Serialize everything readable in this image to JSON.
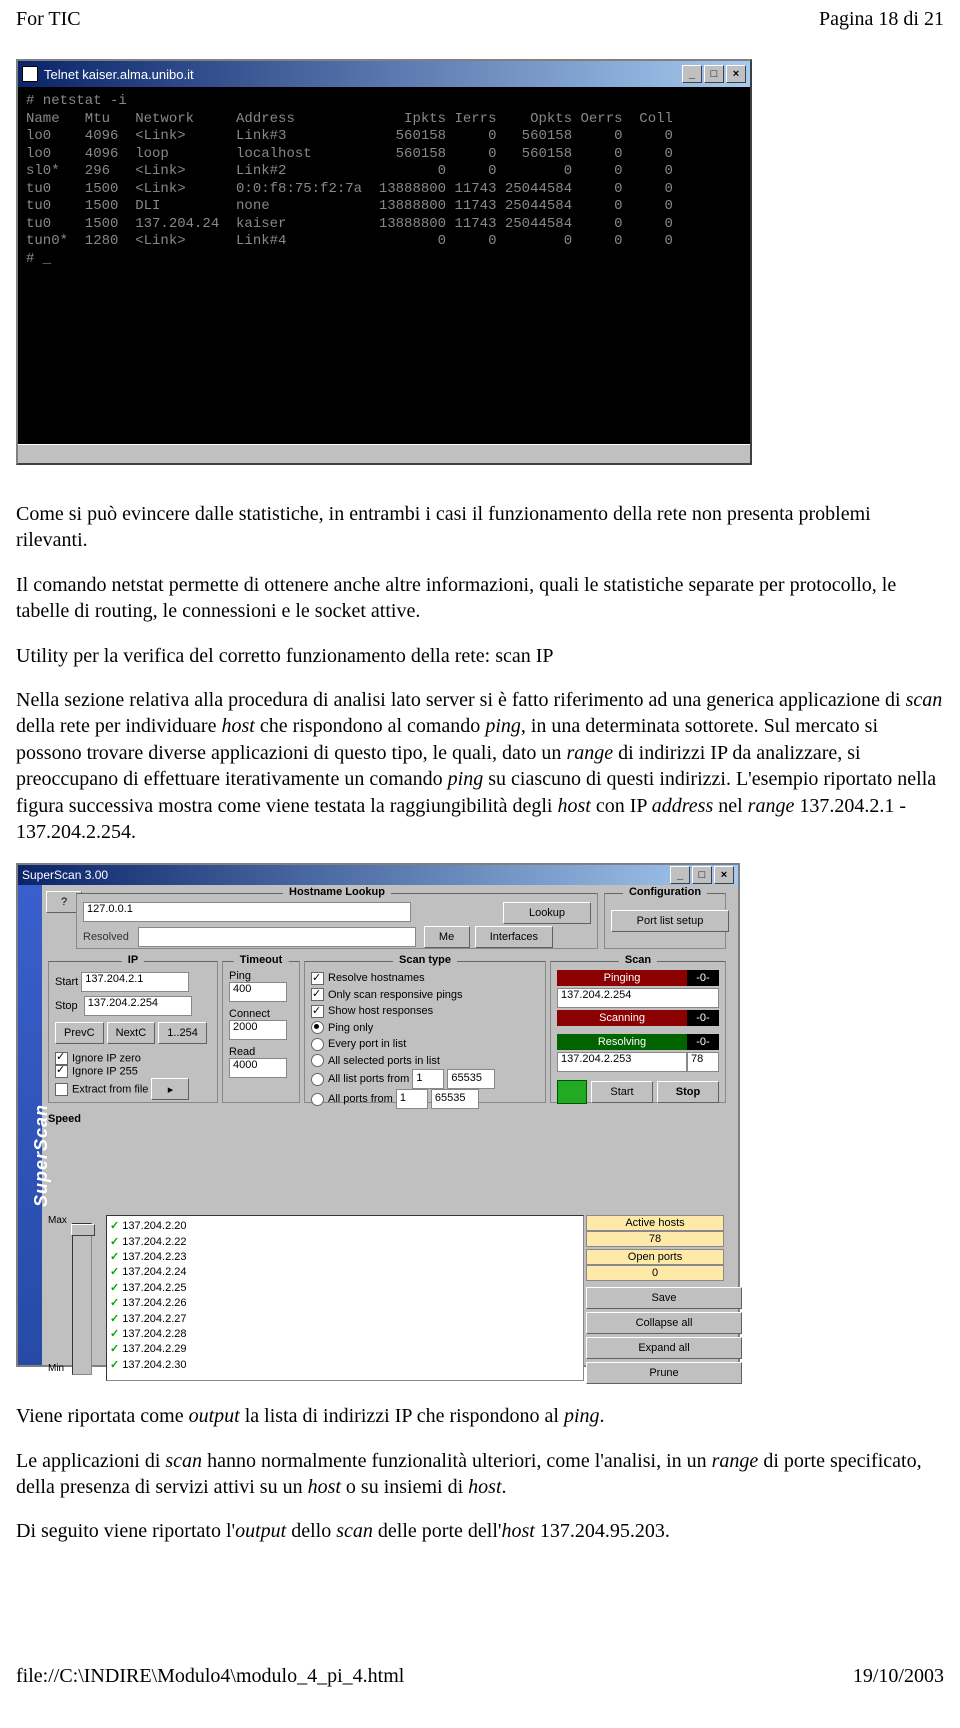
{
  "header": {
    "left": "For TIC",
    "right": "Pagina 18 di 21"
  },
  "telnet": {
    "title": "Telnet kaiser.alma.unibo.it",
    "cmd": "# netstat -i",
    "cols": "Name   Mtu   Network     Address             Ipkts Ierrs    Opkts Oerrs  Coll",
    "rows": [
      "lo0    4096  <Link>      Link#3             560158     0   560158     0     0",
      "lo0    4096  loop        localhost          560158     0   560158     0     0",
      "sl0*   296   <Link>      Link#2                  0     0        0     0     0",
      "tu0    1500  <Link>      0:0:f8:75:f2:7a  13888800 11743 25044584     0     0",
      "tu0    1500  DLI         none             13888800 11743 25044584     0     0",
      "tu0    1500  137.204.24  kaiser           13888800 11743 25044584     0     0",
      "tun0*  1280  <Link>      Link#4                  0     0        0     0     0",
      "# _"
    ]
  },
  "para1": "Come si può evincere dalle statistiche, in entrambi i casi il funzionamento della rete non presenta problemi rilevanti.",
  "para2": "Il comando netstat permette di ottenere anche altre informazioni, quali le statistiche separate per protocollo, le tabelle di routing, le connessioni e le socket attive.",
  "para3_title": "Utility per la verifica del corretto funzionamento della rete: scan IP",
  "para4_a": "Nella sezione relativa alla procedura di analisi lato server si è fatto riferimento ad una generica applicazione di ",
  "para4_b": "scan",
  "para4_c": " della rete per individuare ",
  "para4_d": "host",
  "para4_e": " che rispondono al comando ",
  "para4_f": "ping",
  "para4_g": ", in una determinata sottorete. Sul mercato si possono trovare diverse applicazioni di questo tipo, le quali, dato un ",
  "para4_h": "range",
  "para4_i": " di indirizzi IP da analizzare, si preoccupano di effettuare iterativamente un comando ",
  "para4_j": "ping",
  "para4_k": " su ciascuno di questi indirizzi. L'esempio riportato nella figura successiva mostra come viene testata la raggiungibilità degli ",
  "para4_l": "host",
  "para4_m": " con IP ",
  "para4_n": "address",
  "para4_o": " nel ",
  "para4_p": "range",
  "para4_q": " 137.204.2.1 - 137.204.2.254.",
  "superscan": {
    "title": "SuperScan 3.00",
    "hostname_lookup": "Hostname Lookup",
    "hostname_value": "127.0.0.1",
    "resolved_label": "Resolved",
    "lookup_btn": "Lookup",
    "me_btn": "Me",
    "interfaces_btn": "Interfaces",
    "configuration": "Configuration",
    "portlist_btn": "Port list setup",
    "ip_label": "IP",
    "start_label": "Start",
    "stop_label": "Stop",
    "start_ip": "137.204.2.1",
    "stop_ip": "137.204.2.254",
    "prevc": "PrevC",
    "nextc": "NextC",
    "one254": "1..254",
    "ignore_zero": "Ignore IP zero",
    "ignore_255": "Ignore IP 255",
    "extract": "Extract from file",
    "timeout": "Timeout",
    "ping_label": "Ping",
    "ping_val": "400",
    "connect_label": "Connect",
    "connect_val": "2000",
    "read_label": "Read",
    "read_val": "4000",
    "scantype": "Scan type",
    "resolve_host": "Resolve hostnames",
    "only_responsive": "Only scan responsive pings",
    "show_host": "Show host responses",
    "ping_only": "Ping only",
    "every_port": "Every port in list",
    "all_selected": "All selected ports in list",
    "all_list_from": "All list ports from",
    "all_ports_from": "All ports from",
    "port_from": "1",
    "port_to": "65535",
    "scan": "Scan",
    "pinging": "Pinging",
    "pinging_ip": "137.204.2.254",
    "scanning": "Scanning",
    "resolving": "Resolving",
    "resolving_ip": "137.204.2.253",
    "resolving_n": "78",
    "start_btn": "Start",
    "stop_btn": "Stop",
    "speed": "Speed",
    "max": "Max",
    "min": "Min",
    "ips": [
      "137.204.2.20",
      "137.204.2.22",
      "137.204.2.23",
      "137.204.2.24",
      "137.204.2.25",
      "137.204.2.26",
      "137.204.2.27",
      "137.204.2.28",
      "137.204.2.29",
      "137.204.2.30"
    ],
    "active_hosts_lbl": "Active hosts",
    "active_hosts": "78",
    "open_ports_lbl": "Open ports",
    "open_ports": "0",
    "save": "Save",
    "collapse": "Collapse all",
    "expand": "Expand all",
    "prune": "Prune"
  },
  "para5_a": "Viene riportata come ",
  "para5_b": "output",
  "para5_c": " la lista di indirizzi IP che rispondono al ",
  "para5_d": "ping",
  "para5_e": ".",
  "para6_a": "Le applicazioni di ",
  "para6_b": "scan",
  "para6_c": " hanno normalmente funzionalità ulteriori, come l'analisi, in un ",
  "para6_d": "range",
  "para6_e": " di porte specificato, della presenza di servizi attivi su un ",
  "para6_f": "host",
  "para6_g": " o su insiemi di ",
  "para6_h": "host",
  "para6_i": ".",
  "para7_a": "Di seguito viene riportato l'",
  "para7_b": "output",
  "para7_c": " dello ",
  "para7_d": "scan",
  "para7_e": " delle porte dell'",
  "para7_f": "host",
  "para7_g": " 137.204.95.203.",
  "footer": {
    "left": "file://C:\\INDIRE\\Modulo4\\modulo_4_pi_4.html",
    "right": "19/10/2003"
  }
}
